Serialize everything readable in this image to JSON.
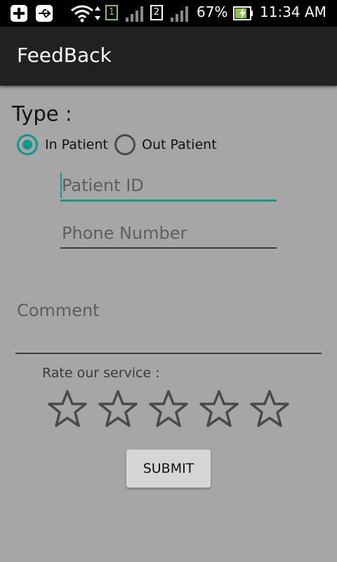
{
  "status_bar": {
    "battery_percent": "67%",
    "time": "11:34 AM",
    "sim1_label": "1",
    "sim2_label": "2"
  },
  "app_bar": {
    "title": "FeedBack"
  },
  "form": {
    "type_label": "Type :",
    "radio_options": [
      {
        "label": "In Patient",
        "checked": true
      },
      {
        "label": "Out Patient",
        "checked": false
      }
    ],
    "patient_id": {
      "value": "",
      "placeholder": "Patient ID"
    },
    "phone_number": {
      "value": "",
      "placeholder": "Phone Number"
    },
    "comment": {
      "value": "",
      "placeholder": "Comment"
    },
    "rating": {
      "label": "Rate our service :",
      "max_stars": 5,
      "value": 0
    },
    "submit_label": "SUBMIT"
  },
  "colors": {
    "accent": "#13978a",
    "background": "#a6a6a6",
    "app_bar": "#212121"
  }
}
